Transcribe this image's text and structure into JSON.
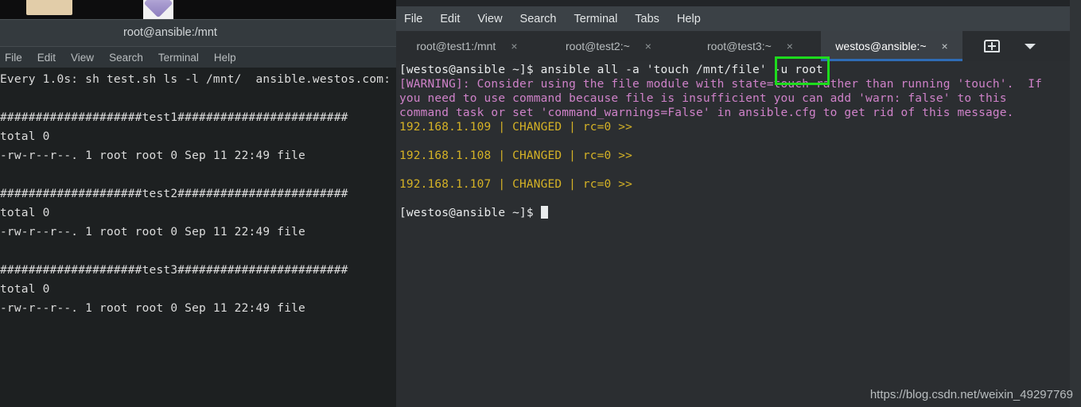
{
  "desktop": {
    "icons": [
      {
        "name": "folder-icon"
      },
      {
        "name": "archive-gem-icon"
      }
    ]
  },
  "left_window": {
    "title": "root@ansible:/mnt",
    "menu": [
      "File",
      "Edit",
      "View",
      "Search",
      "Terminal",
      "Help"
    ],
    "terminal_lines": [
      "Every 1.0s: sh test.sh ls -l /mnt/  ansible.westos.com:",
      "",
      "####################test1########################",
      "total 0",
      "-rw-r--r--. 1 root root 0 Sep 11 22:49 file",
      "",
      "####################test2########################",
      "total 0",
      "-rw-r--r--. 1 root root 0 Sep 11 22:49 file",
      "",
      "####################test3########################",
      "total 0",
      "-rw-r--r--. 1 root root 0 Sep 11 22:49 file"
    ]
  },
  "right_window": {
    "menu": [
      "File",
      "Edit",
      "View",
      "Search",
      "Terminal",
      "Tabs",
      "Help"
    ],
    "tabs": [
      {
        "label": "root@test1:/mnt",
        "close": "×",
        "active": false
      },
      {
        "label": "root@test2:~",
        "close": "×",
        "active": false
      },
      {
        "label": "root@test3:~",
        "close": "×",
        "active": false
      },
      {
        "label": "westos@ansible:~",
        "close": "×",
        "active": true
      }
    ],
    "tab_actions": {
      "add_tab": "new-tab-icon",
      "dropdown": "chevron-down-icon"
    },
    "terminal_lines": [
      {
        "text": "[westos@ansible ~]$ ansible all -a 'touch /mnt/file' -u root",
        "color": "white"
      },
      {
        "text": "[WARNING]: Consider using the file module with state=touch rather than running 'touch'.  If",
        "color": "magenta"
      },
      {
        "text": "you need to use command because file is insufficient you can add 'warn: false' to this",
        "color": "magenta"
      },
      {
        "text": "command task or set 'command_warnings=False' in ansible.cfg to get rid of this message.",
        "color": "magenta"
      },
      {
        "text": "192.168.1.109 | CHANGED | rc=0 >>",
        "color": "yellow"
      },
      {
        "text": "",
        "color": "white"
      },
      {
        "text": "192.168.1.108 | CHANGED | rc=0 >>",
        "color": "yellow"
      },
      {
        "text": "",
        "color": "white"
      },
      {
        "text": "192.168.1.107 | CHANGED | rc=0 >>",
        "color": "yellow"
      },
      {
        "text": "",
        "color": "white"
      },
      {
        "text": "[westos@ansible ~]$ ",
        "color": "white",
        "cursor": true
      }
    ]
  },
  "annotation": {
    "highlight_text": "-u root",
    "color": "#1ddb1d"
  },
  "watermark": "https://blog.csdn.net/weixin_49297769"
}
